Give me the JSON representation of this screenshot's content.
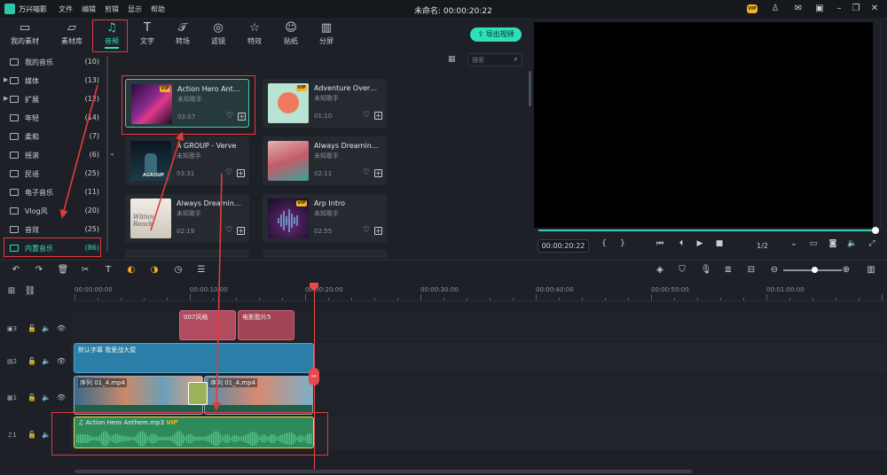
{
  "app": {
    "name": "万兴喵影",
    "title": "未命名: 00:00:20:22",
    "menu": [
      "文件",
      "编辑",
      "剪辑",
      "显示",
      "帮助"
    ]
  },
  "titlebar_icons": [
    "vip-icon",
    "user-icon",
    "feedback-icon",
    "cart-icon",
    "minimize-icon",
    "restore-icon",
    "close-icon"
  ],
  "titlebar_vip": "VIP",
  "media_tabs": [
    {
      "label": "我的素材",
      "icon": "folder-icon"
    },
    {
      "label": "素材库",
      "icon": "library-icon"
    },
    {
      "label": "音频",
      "icon": "music-note-icon",
      "active": true
    },
    {
      "label": "文字",
      "icon": "text-icon"
    },
    {
      "label": "转场",
      "icon": "transition-icon"
    },
    {
      "label": "滤镜",
      "icon": "filter-icon"
    },
    {
      "label": "特效",
      "icon": "effects-icon"
    },
    {
      "label": "贴纸",
      "icon": "sticker-icon"
    },
    {
      "label": "分屏",
      "icon": "split-screen-icon"
    }
  ],
  "export_label": "导出视频",
  "search": {
    "placeholder": "搜索"
  },
  "folders": [
    {
      "name": "我的音乐",
      "count": "(10)",
      "arrow": ""
    },
    {
      "name": "媒体",
      "count": "(13)",
      "arrow": "▶"
    },
    {
      "name": "扩展",
      "count": "(12)",
      "arrow": "▶"
    },
    {
      "name": "年轻",
      "count": "(14)",
      "arrow": ""
    },
    {
      "name": "柔和",
      "count": "(7)",
      "arrow": ""
    },
    {
      "name": "摇滚",
      "count": "(6)",
      "arrow": ""
    },
    {
      "name": "民谣",
      "count": "(25)",
      "arrow": ""
    },
    {
      "name": "电子音乐",
      "count": "(11)",
      "arrow": ""
    },
    {
      "name": "Vlog风",
      "count": "(20)",
      "arrow": ""
    },
    {
      "name": "音效",
      "count": "(25)",
      "arrow": ""
    },
    {
      "name": "内置音乐",
      "count": "(86)",
      "arrow": "",
      "selected": true
    }
  ],
  "cards": [
    {
      "title": "Action Hero Ant…",
      "artist": "未知歌手",
      "duration": "03:07",
      "vip": "VIP",
      "color": "#7a2a86"
    },
    {
      "title": "Adventure Over…",
      "artist": "未知歌手",
      "duration": "01:10",
      "vip": "VIP",
      "color": "#e6735e"
    },
    {
      "title": "A GROUP - Verve",
      "artist": "未知歌手",
      "duration": "03:31",
      "vip": "",
      "color": "#1a2a3a"
    },
    {
      "title": "Always Dreamin…",
      "artist": "未知歌手",
      "duration": "02:11",
      "vip": "",
      "color": "#c36b72"
    },
    {
      "title": "Always Dreamin…",
      "artist": "未知歌手",
      "duration": "02:19",
      "vip": "",
      "color": "#d9d4cc"
    },
    {
      "title": "Arp Intro",
      "artist": "未知歌手",
      "duration": "02:55",
      "vip": "VIP",
      "color": "#2a1e3c"
    }
  ],
  "card_a_group_thumb_text": "AGROUP",
  "card_always_thumb_text": "Within Reach",
  "preview": {
    "time": "00:00:20:22",
    "ratio": "1/2"
  },
  "timeline": {
    "ruler": [
      "00:00:00:00",
      "00:00:10:00",
      "00:00:20:00",
      "00:00:30:00",
      "00:00:40:00",
      "00:00:50:00",
      "00:01:00:00"
    ],
    "tracks": [
      {
        "num": "3",
        "icon": "effect-track-icon"
      },
      {
        "num": "2",
        "icon": "text-track-icon"
      },
      {
        "num": "1",
        "icon": "video-track-icon"
      },
      {
        "num": "1",
        "icon": "audio-track-icon"
      }
    ],
    "clips": {
      "effect1": "007风格",
      "effect2": "电影胶片5",
      "text": "默认字幕 我爱战大屋",
      "video1": "序列 01_4.mp4",
      "video2": "序列 01_4.mp4",
      "audio": "Action Hero Anthem.mp3",
      "audio_vip": "VIP"
    }
  },
  "colors": {
    "accent": "#2ee0c0",
    "annotation": "#e23b3b",
    "effect_clip": "#b24a60",
    "text_clip": "#2b7ea8",
    "audio_clip": "#2f8a5b"
  }
}
